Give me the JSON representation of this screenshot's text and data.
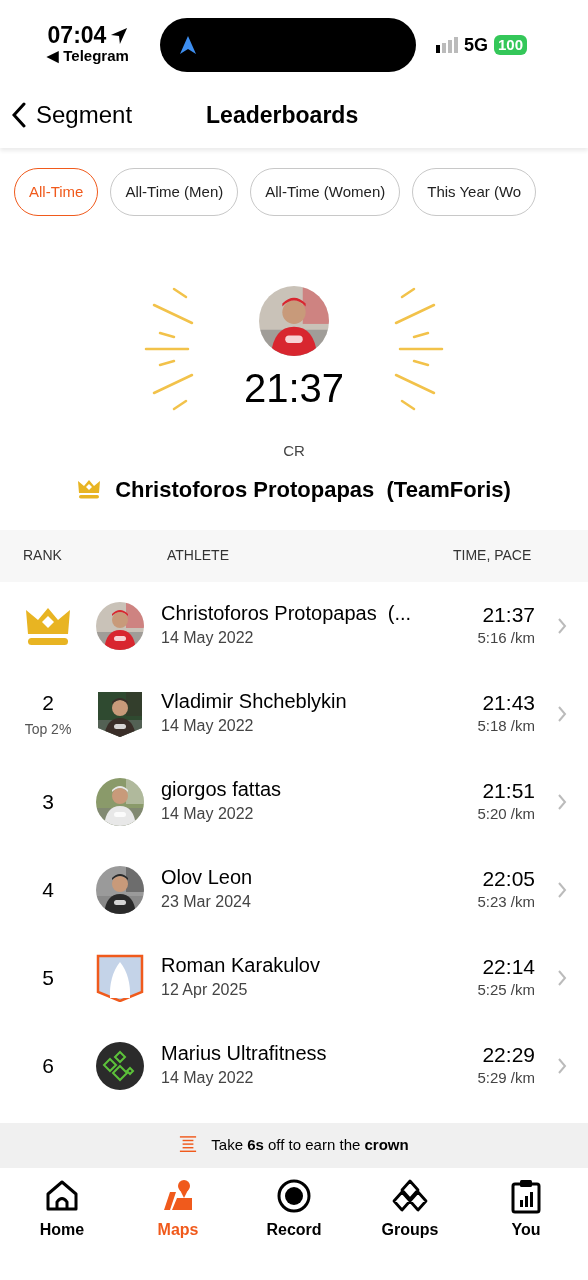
{
  "status_bar": {
    "time": "07:04",
    "back_app": "◀ Telegram",
    "network": "5G",
    "battery": "100"
  },
  "header": {
    "back_label": "Segment",
    "title": "Leaderboards"
  },
  "filters": [
    {
      "label": "All-Time",
      "selected": true
    },
    {
      "label": "All-Time (Men)",
      "selected": false
    },
    {
      "label": "All-Time (Women)",
      "selected": false
    },
    {
      "label": "This Year (Wo",
      "selected": false
    }
  ],
  "hero": {
    "time": "21:37",
    "label": "CR",
    "holder": "Christoforos Protopapas  (TeamForis)"
  },
  "table": {
    "columns": [
      "RANK",
      "ATHLETE",
      "TIME, PACE"
    ],
    "rows": [
      {
        "kind": "crown",
        "avatar": {
          "kind": "circle"
        },
        "name": "Christoforos Protopapas  (...",
        "date": "14 May 2022",
        "time": "21:37",
        "pace": "5:16 /km"
      },
      {
        "kind": "number",
        "rank": "2",
        "percentile": "Top 2%",
        "avatar": {
          "kind": "shield"
        },
        "name": "Vladimir Shcheblykin",
        "date": "14 May 2022",
        "time": "21:43",
        "pace": "5:18 /km"
      },
      {
        "kind": "number",
        "rank": "3",
        "avatar": {
          "kind": "circle"
        },
        "name": "giorgos fattas",
        "date": "14 May 2022",
        "time": "21:51",
        "pace": "5:20 /km"
      },
      {
        "kind": "number",
        "rank": "4",
        "avatar": {
          "kind": "circle"
        },
        "name": "Olov Leon",
        "date": "23 Mar 2024",
        "time": "22:05",
        "pace": "5:23 /km"
      },
      {
        "kind": "number",
        "rank": "5",
        "avatar": {
          "kind": "placeholder"
        },
        "name": "Roman Karakulov",
        "date": "12 Apr 2025",
        "time": "22:14",
        "pace": "5:25 /km"
      },
      {
        "kind": "number",
        "rank": "6",
        "avatar": {
          "kind": "logo"
        },
        "name": "Marius Ultrafitness",
        "date": "14 May 2022",
        "time": "22:29",
        "pace": "5:29 /km"
      }
    ]
  },
  "banner": "Take **6s** off to earn the **crown**",
  "nav": [
    {
      "label": "Home",
      "kind": "home",
      "selected": false
    },
    {
      "label": "Maps",
      "kind": "maps",
      "selected": true
    },
    {
      "label": "Record",
      "kind": "record",
      "selected": false
    },
    {
      "label": "Groups",
      "kind": "groups",
      "selected": false
    },
    {
      "label": "You",
      "kind": "you",
      "selected": false
    }
  ]
}
